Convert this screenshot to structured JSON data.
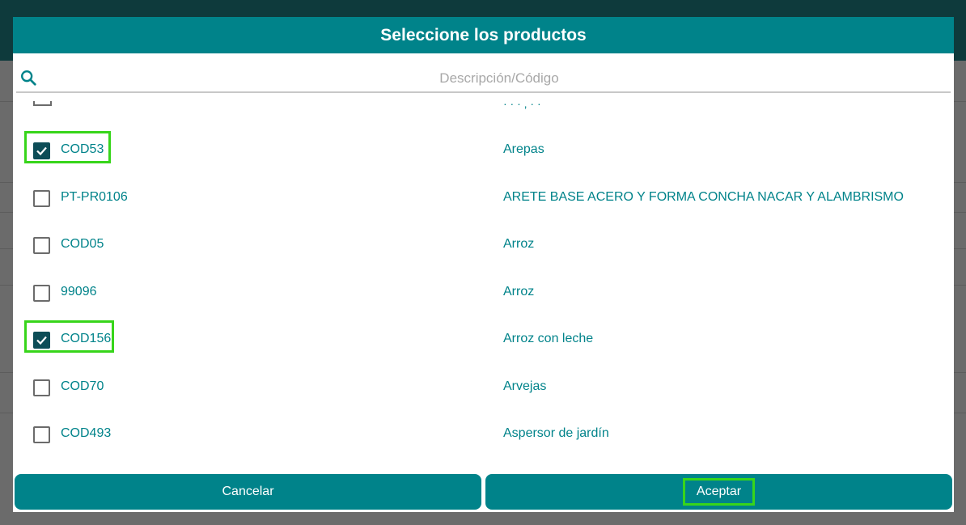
{
  "dialog": {
    "title": "Seleccione los productos",
    "search_placeholder": "Descripción/Código",
    "cancel_label": "Cancelar",
    "accept_label": "Aceptar"
  },
  "partial_row": {
    "description_fragment": "· · · , · ·"
  },
  "products": [
    {
      "code": "COD53",
      "description": "Arepas",
      "checked": true,
      "highlighted": true
    },
    {
      "code": "PT-PR0106",
      "description": "ARETE BASE ACERO Y FORMA CONCHA NACAR Y ALAMBRISMO",
      "checked": false,
      "highlighted": false
    },
    {
      "code": "COD05",
      "description": "Arroz",
      "checked": false,
      "highlighted": false
    },
    {
      "code": "99096",
      "description": "Arroz",
      "checked": false,
      "highlighted": false
    },
    {
      "code": "COD156",
      "description": "Arroz con leche",
      "checked": true,
      "highlighted": true
    },
    {
      "code": "COD70",
      "description": "Arvejas",
      "checked": false,
      "highlighted": false
    },
    {
      "code": "COD493",
      "description": "Aspersor de jardín",
      "checked": false,
      "highlighted": false
    }
  ],
  "colors": {
    "header": "#00838a",
    "accent_text": "#00838a",
    "checkbox_checked": "#0d4d57",
    "highlight": "#37d51a"
  }
}
